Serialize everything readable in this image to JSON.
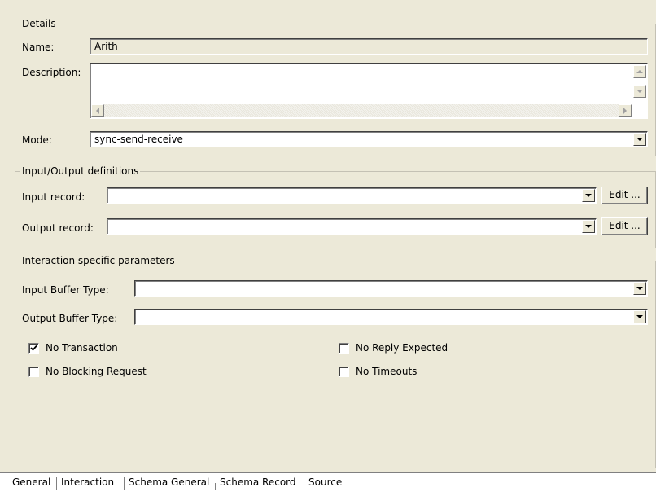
{
  "details": {
    "legend": "Details",
    "name_label": "Name:",
    "name_value": "Arith",
    "description_label": "Description:",
    "description_value": "",
    "mode_label": "Mode:",
    "mode_value": "sync-send-receive"
  },
  "io": {
    "legend": "Input/Output definitions",
    "input_label": "Input record:",
    "input_value": "",
    "output_label": "Output record:",
    "output_value": "",
    "edit_label": "Edit ..."
  },
  "interaction": {
    "legend": "Interaction specific parameters",
    "input_buffer_label": "Input Buffer Type:",
    "input_buffer_value": "",
    "output_buffer_label": "Output Buffer Type:",
    "output_buffer_value": "",
    "checkboxes": [
      {
        "label": "No Transaction",
        "checked": true
      },
      {
        "label": "No Reply Expected",
        "checked": false
      },
      {
        "label": "No Blocking Request",
        "checked": false
      },
      {
        "label": "No Timeouts",
        "checked": false
      }
    ]
  },
  "tabs": [
    "General",
    "Interaction",
    "Schema General",
    "Schema Record",
    "Source"
  ],
  "active_tab": "Interaction",
  "icons": {
    "dropdown": "chevron-down-icon",
    "check": "check-icon"
  },
  "colors": {
    "panel_bg": "#ece9d8",
    "field_border": "#7f9db9"
  }
}
